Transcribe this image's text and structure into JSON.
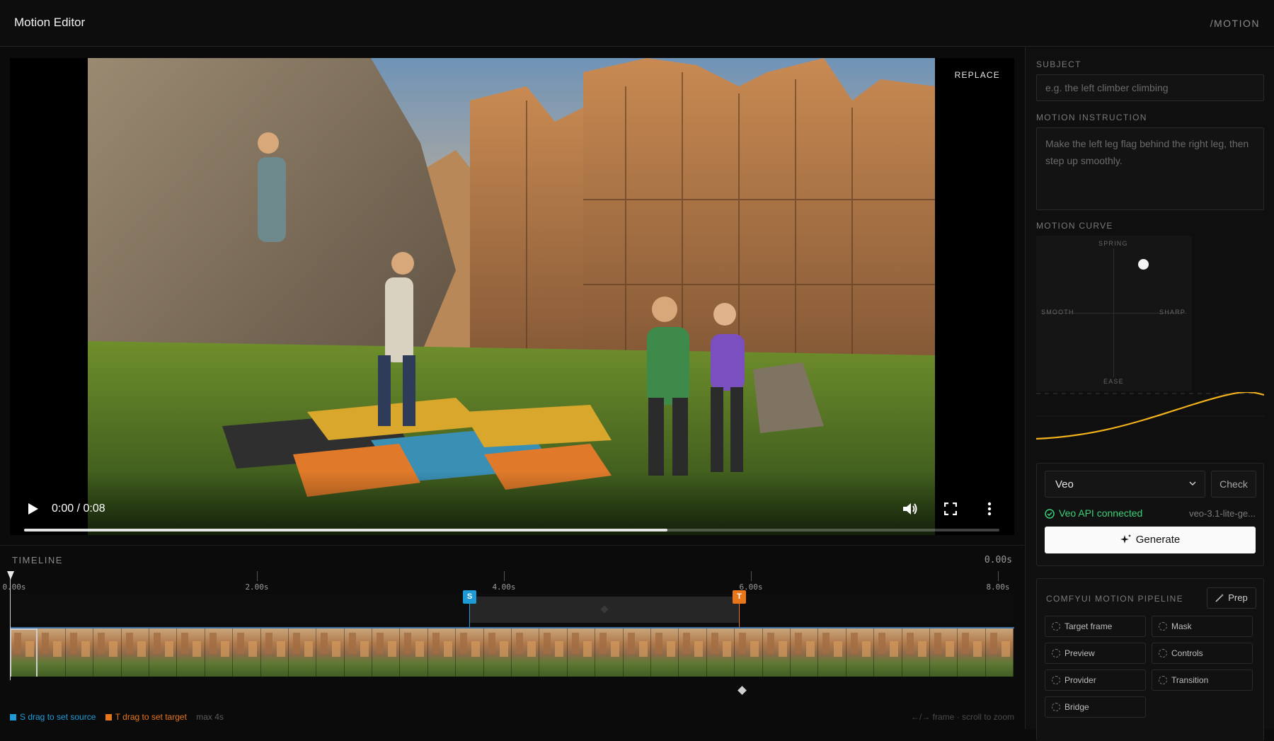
{
  "header": {
    "title": "Motion Editor",
    "route": "/MOTION"
  },
  "video": {
    "replace_label": "REPLACE",
    "time": "0:00 / 0:08",
    "progress": 0.66,
    "icons": [
      "play-icon",
      "volume-icon",
      "fullscreen-icon",
      "more-vert-icon"
    ]
  },
  "timeline": {
    "label": "TIMELINE",
    "current_time": "0.00s",
    "ticks": [
      "0.00s",
      "2.00s",
      "4.00s",
      "6.00s",
      "8.00s"
    ],
    "source_marker": "S",
    "target_marker": "T",
    "legend_source": "S drag to set source",
    "legend_target": "T drag to set target",
    "legend_max": "max 4s",
    "hint": "←/→ frame · scroll to zoom",
    "colors": {
      "source": "#1e9bd7",
      "target": "#e8761b"
    }
  },
  "panel": {
    "subject_label": "SUBJECT",
    "subject_placeholder": "e.g. the left climber climbing",
    "instruction_label": "MOTION INSTRUCTION",
    "instruction_placeholder": "Make the left leg flag behind the right leg, then step up smoothly.",
    "curve_label": "MOTION CURVE",
    "curve_axes": {
      "top": "SPRING",
      "left": "SMOOTH",
      "right": "SHARP",
      "bottom": "EASE"
    },
    "curve_color": "#f2b21b",
    "provider": "Veo",
    "check_label": "Check",
    "status": "Veo API connected",
    "model": "veo-3.1-lite-ge...",
    "generate_label": "Generate",
    "pipeline_label": "COMFYUI MOTION PIPELINE",
    "prep_label": "Prep",
    "steps": [
      "Target frame",
      "Mask",
      "Preview",
      "Controls",
      "Provider",
      "Transition",
      "Bridge"
    ]
  }
}
